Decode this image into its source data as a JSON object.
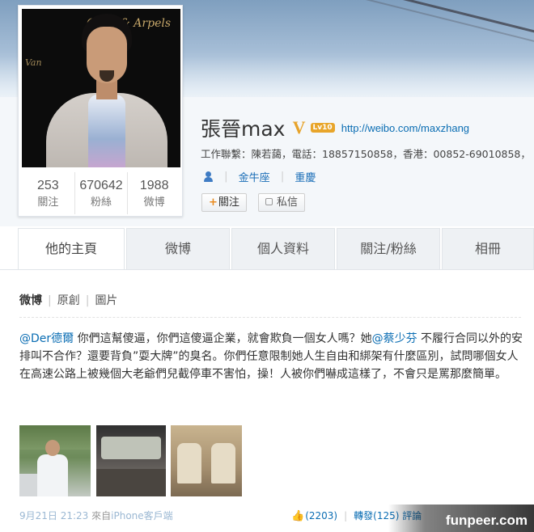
{
  "profile": {
    "name": "張晉max",
    "level_badge": "Lv10",
    "url": "http://weibo.com/maxzhang",
    "contact": "工作聯繫：陳若藹，電話：18857150858，香港：00852-69010858，",
    "zodiac": "金牛座",
    "location": "重慶",
    "follow_label": "關注",
    "message_label": "私信"
  },
  "stats": [
    {
      "value": "253",
      "label": "關注"
    },
    {
      "value": "670642",
      "label": "粉絲"
    },
    {
      "value": "1988",
      "label": "微博"
    }
  ],
  "avatar": {
    "sign_text": "Cleef & Arpels",
    "sign_left": "Van"
  },
  "tabs": [
    {
      "label": "他的主頁"
    },
    {
      "label": "微博"
    },
    {
      "label": "個人資料"
    },
    {
      "label": "關注/粉絲"
    },
    {
      "label": "相冊"
    }
  ],
  "subtabs": [
    "微博",
    "原創",
    "圖片"
  ],
  "post": {
    "mention1": "@Der德爾",
    "text1": " 你們這幫傻逼，你們這傻逼企業，就會欺負一個女人嗎？她",
    "mention2": "@蔡少芬",
    "text2": " 不履行合同以外的安排叫不合作？還要背負”耍大牌”的臭名。你們任意限制她人生自由和綁架有什麼區別，試問哪個女人在高速公路上被幾個大老爺們兒截停車不害怕，操！人被你們嚇成這樣了，不會只是罵那麼簡單。",
    "time": "9月21日 21:23",
    "source_prefix": "來自",
    "source": "iPhone客戶端",
    "likes": "(2203)",
    "reposts": "轉發(125)",
    "comment_label": "評論"
  },
  "watermark": "funpeer.com",
  "colors": {
    "link": "#0a6db3",
    "verified": "#e7a32a",
    "tab_bg": "#eef1f4"
  }
}
